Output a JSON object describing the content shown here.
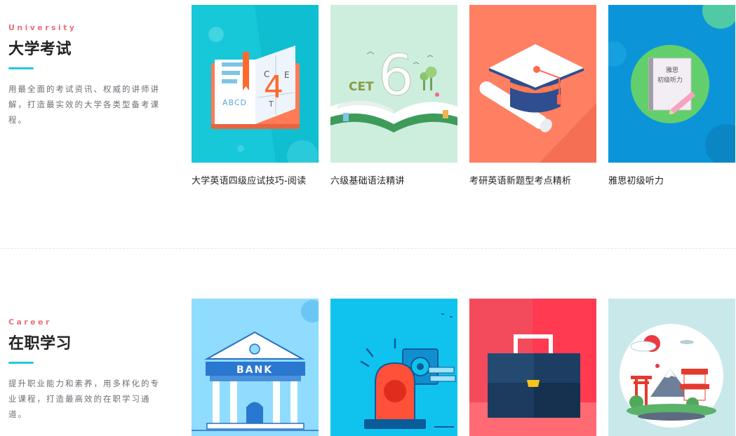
{
  "sections": [
    {
      "eyebrow": "University",
      "title": "大学考试",
      "description": "用最全面的考试资讯、权威的讲师讲解，打造最实效的大学各类型备考课程。",
      "courses": [
        {
          "title": "大学英语四级应试技巧-阅读",
          "art": {
            "letters": [
              "C",
              "E",
              "T",
              "4"
            ],
            "word": "ABCD"
          }
        },
        {
          "title": "六级基础语法精讲",
          "art": {
            "word": "CET",
            "digit": "6"
          }
        },
        {
          "title": "考研英语新题型考点精析"
        },
        {
          "title": "雅思初级听力",
          "art": {
            "book_line1": "雅思",
            "book_line2": "初级听力"
          }
        }
      ]
    },
    {
      "eyebrow": "Career",
      "title": "在职学习",
      "description": "提升职业能力和素养，用多样化的专业课程，打造最高效的在职学习通道。",
      "courses": [
        {
          "art": {
            "sign": "BANK"
          }
        },
        {},
        {},
        {}
      ]
    }
  ],
  "colors": {
    "accent_line": "#22c7e0",
    "eyebrow": "#e8727a",
    "card_cet4": "#16c8d8",
    "card_cet6": "#cdeedd",
    "card_kaoyan": "#ff7f63",
    "card_ielts": "#0b95d8",
    "card_bank": "#8fdcff",
    "card_alarm": "#10c3ee",
    "card_briefcase": "#f34b5c",
    "card_japan": "#c8e8ea"
  }
}
